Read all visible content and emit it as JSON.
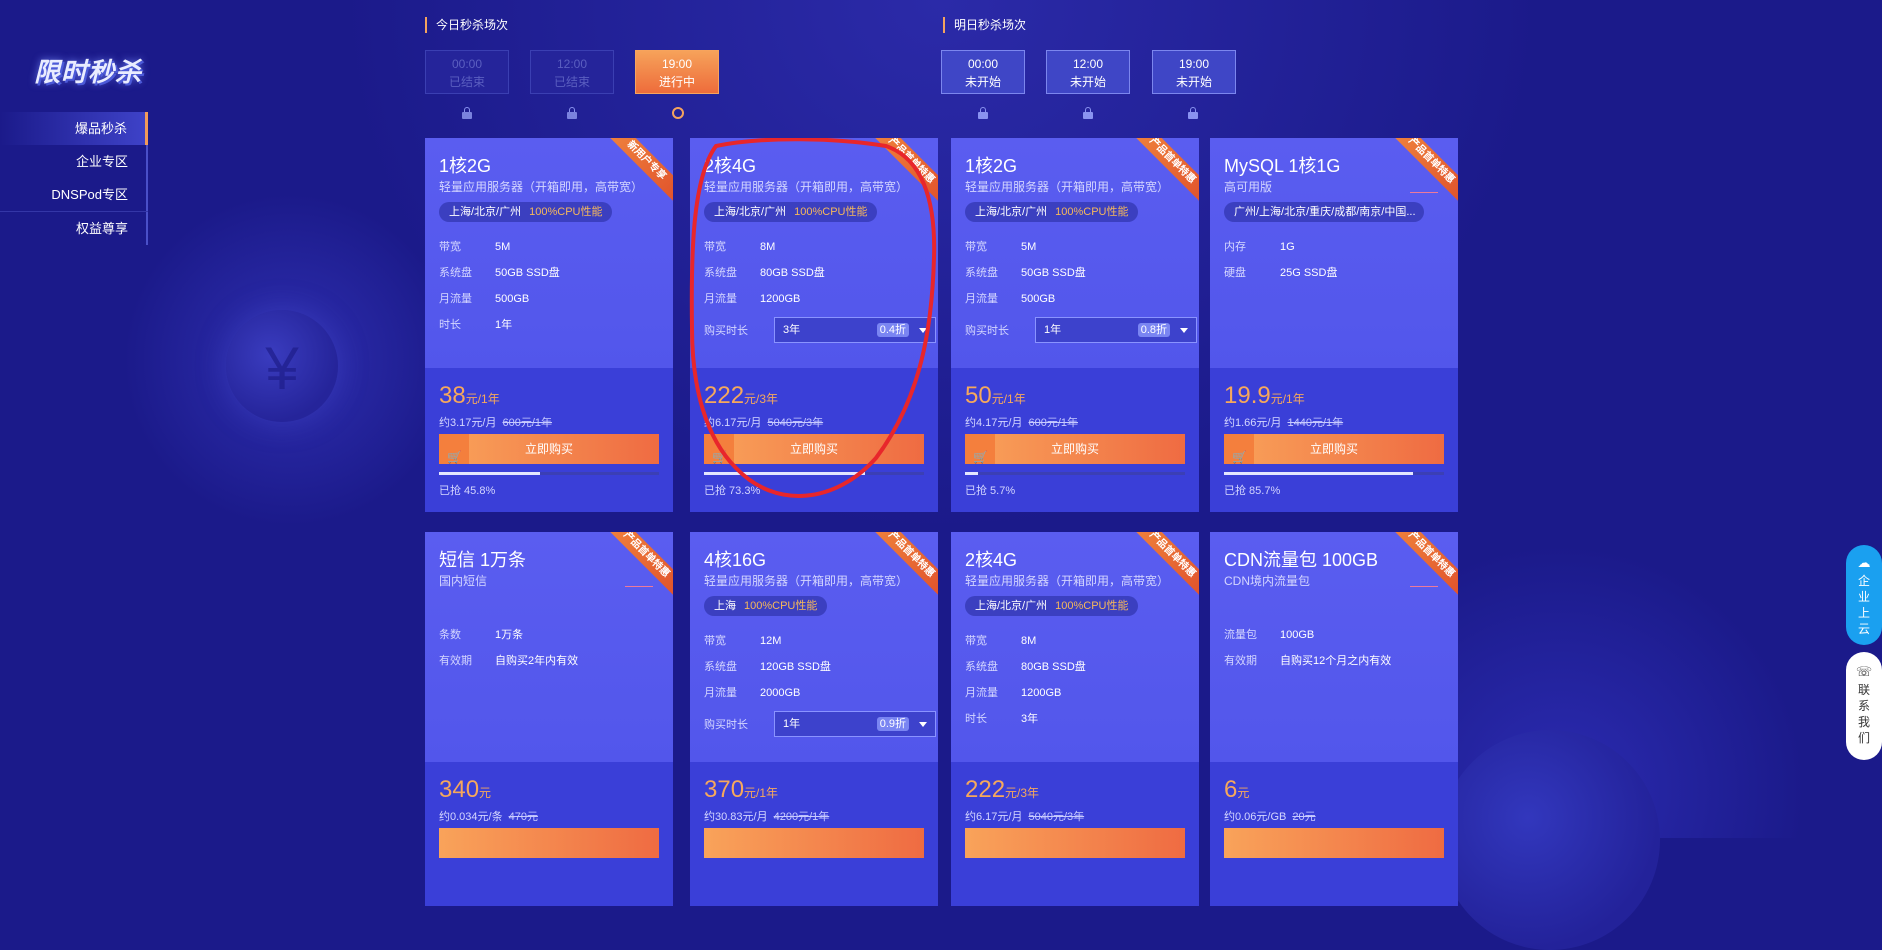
{
  "logo": {
    "text": "限时秒杀"
  },
  "sidenav": [
    {
      "label": "爆品秒杀",
      "active": true
    },
    {
      "label": "企业专区",
      "active": false
    },
    {
      "label": "DNSPod专区",
      "active": false
    },
    {
      "label": "权益尊享",
      "active": false
    }
  ],
  "sessions": {
    "today_title": "今日秒杀场次",
    "tomorrow_title": "明日秒杀场次",
    "today": [
      {
        "time": "00:00",
        "status": "已结束"
      },
      {
        "time": "12:00",
        "status": "已结束"
      },
      {
        "time": "19:00",
        "status": "进行中"
      }
    ],
    "tomorrow": [
      {
        "time": "00:00",
        "status": "未开始"
      },
      {
        "time": "12:00",
        "status": "未开始"
      },
      {
        "time": "19:00",
        "status": "未开始"
      }
    ]
  },
  "cards": [
    {
      "ribbon": "新用户专享",
      "title": "1核2G",
      "subtitle": "轻量应用服务器（开箱即用，高带宽）",
      "region": "上海/北京/广州",
      "cpu": "100%CPU性能",
      "specs": [
        [
          "带宽",
          "5M"
        ],
        [
          "系统盘",
          "50GB SSD盘"
        ],
        [
          "月流量",
          "500GB"
        ],
        [
          "时长",
          "1年"
        ]
      ],
      "price": "38",
      "price_unit": "元/1年",
      "per": "约3.17元/月",
      "orig": "600元/1年",
      "buy": "立即购买",
      "grabbed": "已抢 45.8%",
      "grabbed_pct": 45.8
    },
    {
      "ribbon": "产品首单特惠",
      "title": "2核4G",
      "subtitle": "轻量应用服务器（开箱即用，高带宽）",
      "region": "上海/北京/广州",
      "cpu": "100%CPU性能",
      "specs": [
        [
          "带宽",
          "8M"
        ],
        [
          "系统盘",
          "80GB SSD盘"
        ],
        [
          "月流量",
          "1200GB"
        ]
      ],
      "duration": {
        "label": "购买时长",
        "value": "3年",
        "discount": "0.4折"
      },
      "price": "222",
      "price_unit": "元/3年",
      "per": "约6.17元/月",
      "orig": "5040元/3年",
      "buy": "立即购买",
      "grabbed": "已抢 73.3%",
      "grabbed_pct": 73.3
    },
    {
      "ribbon": "产品首单特惠",
      "title": "1核2G",
      "subtitle": "轻量应用服务器（开箱即用，高带宽）",
      "region": "上海/北京/广州",
      "cpu": "100%CPU性能",
      "specs": [
        [
          "带宽",
          "5M"
        ],
        [
          "系统盘",
          "50GB SSD盘"
        ],
        [
          "月流量",
          "500GB"
        ]
      ],
      "duration": {
        "label": "购买时长",
        "value": "1年",
        "discount": "0.8折"
      },
      "price": "50",
      "price_unit": "元/1年",
      "per": "约4.17元/月",
      "orig": "600元/1年",
      "buy": "立即购买",
      "grabbed": "已抢 5.7%",
      "grabbed_pct": 5.7
    },
    {
      "ribbon": "产品首单特惠",
      "title": "MySQL 1核1G",
      "subtitle": "高可用版",
      "region": "广州/上海/北京/重庆/成都/南京/中国...",
      "cpu": "",
      "specs": [
        [
          "内存",
          "1G"
        ],
        [
          "硬盘",
          "25G SSD盘"
        ]
      ],
      "price": "19.9",
      "price_unit": "元/1年",
      "per": "约1.66元/月",
      "orig": "1440元/1年",
      "buy": "立即购买",
      "grabbed": "已抢 85.7%",
      "grabbed_pct": 85.7
    },
    {
      "ribbon": "产品首单特惠",
      "title": "短信 1万条",
      "subtitle": "国内短信",
      "region": "",
      "cpu": "",
      "specs": [
        [
          "条数",
          "1万条"
        ],
        [
          "有效期",
          "自购买2年内有效"
        ]
      ],
      "price": "340",
      "price_unit": "元",
      "per": "约0.034元/条",
      "orig": "470元"
    },
    {
      "ribbon": "产品首单特惠",
      "title": "4核16G",
      "subtitle": "轻量应用服务器（开箱即用，高带宽）",
      "region": "上海",
      "cpu": "100%CPU性能",
      "specs": [
        [
          "带宽",
          "12M"
        ],
        [
          "系统盘",
          "120GB SSD盘"
        ],
        [
          "月流量",
          "2000GB"
        ]
      ],
      "duration": {
        "label": "购买时长",
        "value": "1年",
        "discount": "0.9折"
      },
      "price": "370",
      "price_unit": "元/1年",
      "per": "约30.83元/月",
      "orig": "4200元/1年"
    },
    {
      "ribbon": "产品首单特惠",
      "title": "2核4G",
      "subtitle": "轻量应用服务器（开箱即用，高带宽）",
      "region": "上海/北京/广州",
      "cpu": "100%CPU性能",
      "specs": [
        [
          "带宽",
          "8M"
        ],
        [
          "系统盘",
          "80GB SSD盘"
        ],
        [
          "月流量",
          "1200GB"
        ],
        [
          "时长",
          "3年"
        ]
      ],
      "price": "222",
      "price_unit": "元/3年",
      "per": "约6.17元/月",
      "orig": "5040元/3年"
    },
    {
      "ribbon": "产品首单特惠",
      "title": "CDN流量包 100GB",
      "subtitle": "CDN境内流量包",
      "region": "",
      "cpu": "",
      "specs": [
        [
          "流量包",
          "100GB"
        ],
        [
          "有效期",
          "自购买12个月之内有效"
        ]
      ],
      "price": "6",
      "price_unit": "元",
      "per": "约0.06元/GB",
      "orig": "20元"
    }
  ],
  "float": {
    "enterprise": "企业上云",
    "contact": "联系我们"
  },
  "colors": {
    "accent": "#f29a5a",
    "bg": "#1b1a8a",
    "card": "#5a5df0",
    "annotation": "#e8262b"
  }
}
